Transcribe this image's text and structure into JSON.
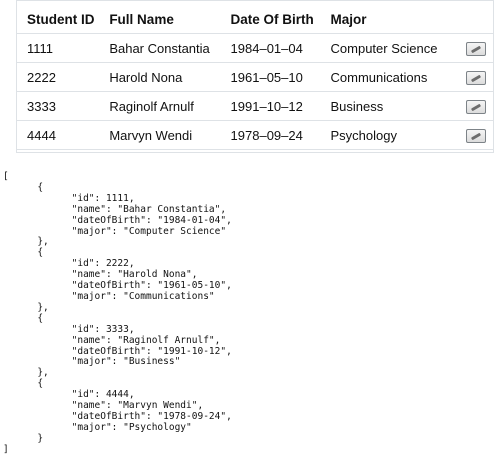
{
  "table": {
    "headers": {
      "id": "Student ID",
      "name": "Full Name",
      "dob": "Date Of Birth",
      "major": "Major"
    },
    "rows": [
      {
        "id": "1111",
        "name": "Bahar Constantia",
        "dob": "1984–01–04",
        "major": "Computer Science"
      },
      {
        "id": "2222",
        "name": "Harold Nona",
        "dob": "1961–05–10",
        "major": "Communications"
      },
      {
        "id": "3333",
        "name": "Raginolf Arnulf",
        "dob": "1991–10–12",
        "major": "Business"
      },
      {
        "id": "4444",
        "name": "Marvyn Wendi",
        "dob": "1978–09–24",
        "major": "Psychology"
      }
    ],
    "edit_icon": "pencil-icon"
  },
  "json_dump": "[\n\t{\n\t\t\"id\": 1111,\n\t\t\"name\": \"Bahar Constantia\",\n\t\t\"dateOfBirth\": \"1984-01-04\",\n\t\t\"major\": \"Computer Science\"\n\t},\n\t{\n\t\t\"id\": 2222,\n\t\t\"name\": \"Harold Nona\",\n\t\t\"dateOfBirth\": \"1961-05-10\",\n\t\t\"major\": \"Communications\"\n\t},\n\t{\n\t\t\"id\": 3333,\n\t\t\"name\": \"Raginolf Arnulf\",\n\t\t\"dateOfBirth\": \"1991-10-12\",\n\t\t\"major\": \"Business\"\n\t},\n\t{\n\t\t\"id\": 4444,\n\t\t\"name\": \"Marvyn Wendi\",\n\t\t\"dateOfBirth\": \"1978-09-24\",\n\t\t\"major\": \"Psychology\"\n\t}\n]"
}
